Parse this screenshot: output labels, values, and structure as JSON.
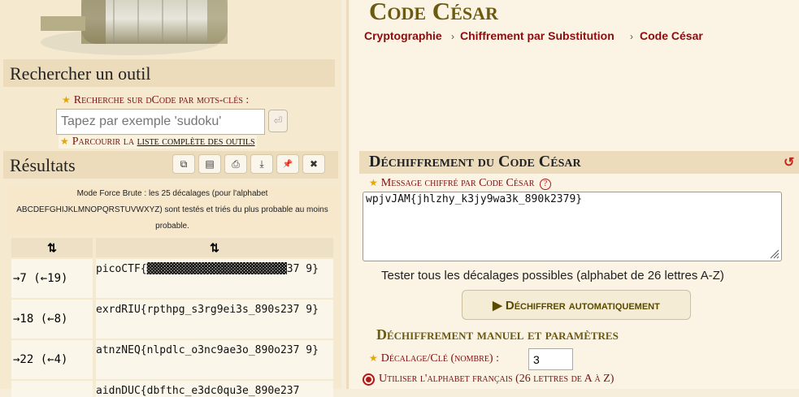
{
  "site": {
    "page_title": "Code César",
    "breadcrumbs": [
      "Cryptographie",
      "Chiffrement par Substitution",
      "Code César"
    ],
    "breadcrumb_sep": "›"
  },
  "left": {
    "search_title": "Rechercher un outil",
    "keyword_label": "Recherche sur dCode par mots-clés :",
    "search_placeholder": "Tapez par exemple 'sudoku'",
    "submit_icon": "⏎",
    "browse_prefix": "Parcourir la ",
    "browse_link": "liste complète des outils",
    "results_title": "Résultats",
    "toolbar_icons": [
      "copy-icon",
      "save-icon",
      "print-icon",
      "download-icon",
      "pin-icon",
      "close-icon"
    ],
    "toolbar_glyphs": [
      "⧉",
      "▤",
      "⎙",
      "⤓",
      "📌",
      "✖"
    ],
    "info_text": "Mode Force Brute : les 25 décalages (pour l'alphabet ABCDEFGHIJKLMNOPQRSTUVWXYZ) sont testés et triés du plus probable au moins probable.",
    "col1_header": "⇅",
    "col2_header": "⇅",
    "rows": [
      {
        "shift": "→7 (←19)",
        "text": "picoCTF{▓▓▓▓▓▓▓▓▓▓▓▓▓▓▓▓▓▓▓▓▓▓37 9}"
      },
      {
        "shift": "→18 (←8)",
        "text": "exrdRIU{rpthpg_s3rg9ei3s_890s237 9}"
      },
      {
        "shift": "→22 (←4)",
        "text": "atnzNEQ{nlpdlc_o3nc9ae3o_890o237 9}"
      },
      {
        "shift": "",
        "text": "aidnDUC{dbfthc_e3dc0qu3e_890e237"
      }
    ]
  },
  "right": {
    "decipher_title": "Déchiffrement du Code César",
    "refresh_icon": "↺",
    "message_label": "Message chiffré par Code César",
    "help_glyph": "?",
    "message_value": "wpjvJAM{jhlzhy_k3jy9wa3k_890k2379}",
    "test_all_label": "Tester tous les décalages possibles (alphabet de 26 lettres A-Z)",
    "auto_button": "▶ Déchiffrer automatiquement",
    "manual_title": "Déchiffrement manuel et paramètres",
    "shift_label": "Décalage/Clé (nombre) :",
    "shift_value": "3",
    "alphabet_option": "Utiliser l'alphabet français (26 lettres de A à Z)"
  },
  "colors": {
    "title_brown": "#6b5a10",
    "link_red": "#8c0c0c",
    "panel_beige": "#ecdcbc"
  }
}
